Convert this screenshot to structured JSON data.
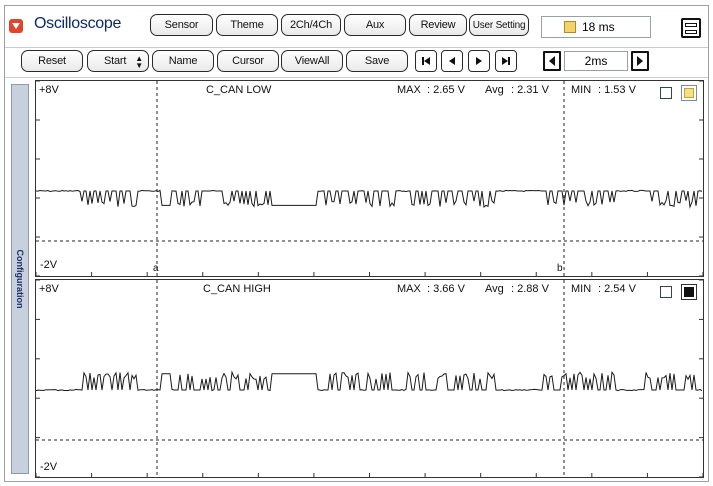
{
  "app": {
    "title": "Oscilloscope"
  },
  "top_tabs": [
    {
      "label": "Sensor"
    },
    {
      "label": "Theme"
    },
    {
      "label": "2Ch/4Ch"
    },
    {
      "label": "Aux"
    },
    {
      "label": "Review"
    },
    {
      "label": "User Setting"
    }
  ],
  "time_display": "18 ms",
  "toolbar": {
    "reset": "Reset",
    "start": "Start",
    "name": "Name",
    "cursor": "Cursor",
    "viewall": "ViewAll",
    "save": "Save",
    "timebase": "2ms"
  },
  "side_tab": {
    "label": "Configuration"
  },
  "channels": [
    {
      "name": "C_CAN LOW",
      "top_label": "+8V",
      "bottom_label": "-2V",
      "max_label": "MAX",
      "max": ": 2.65 V",
      "avg_label": "Avg",
      "avg": ": 2.31 V",
      "min_label": "MIN",
      "min": ": 1.53 V",
      "cursor_a": "a",
      "cursor_b": "b",
      "trace_color": "#1a1a1a"
    },
    {
      "name": "C_CAN HIGH",
      "top_label": "+8V",
      "bottom_label": "-2V",
      "max_label": "MAX",
      "max": ": 3.66 V",
      "avg_label": "Avg",
      "avg": ": 2.88 V",
      "min_label": "MIN",
      "min": ": 2.54 V",
      "trace_color": "#1a1a1a"
    }
  ]
}
